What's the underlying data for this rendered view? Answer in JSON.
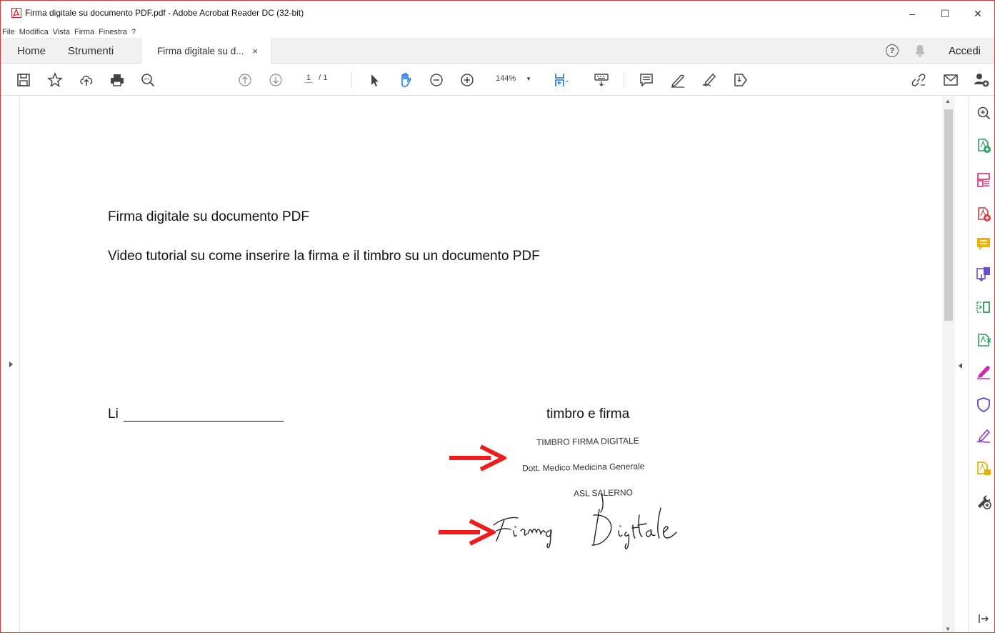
{
  "window": {
    "title": "Firma digitale su documento PDF.pdf - Adobe Acrobat Reader DC (32-bit)",
    "minimize": "–",
    "maximize": "☐",
    "close": "✕"
  },
  "menu": [
    "File",
    "Modifica",
    "Vista",
    "Firma",
    "Finestra",
    "?"
  ],
  "tabs": {
    "home": "Home",
    "tools": "Strumenti",
    "document": "Firma digitale su d...",
    "document_close": "×"
  },
  "header_right": {
    "help": "?",
    "signin": "Accedi"
  },
  "toolbar": {
    "page_current": "1",
    "page_total": "/ 1",
    "zoom": "144%",
    "zoom_arrow": "▼"
  },
  "document": {
    "heading": "Firma digitale su documento PDF",
    "subtitle": "Video tutorial su come inserire la firma e il timbro su un documento PDF",
    "place_label": "Li",
    "stamp_label": "timbro e firma",
    "stamp_lines": [
      "TIMBRO FIRMA DIGITALE",
      "Dott. Medico Medicina Generale",
      "ASL SALERNO"
    ],
    "signature": "Firma Digitale"
  },
  "colors": {
    "arrow": "#ee1c1c",
    "accent_blue": "#1473e6",
    "window_border": "#d23b3b"
  },
  "icons": {
    "toolbar_left": [
      "save-icon",
      "bookmark-star-icon",
      "upload-cloud-icon",
      "print-icon",
      "search-zoom-icon"
    ],
    "toolbar_nav": [
      "page-up-icon",
      "page-down-icon"
    ],
    "toolbar_tools": [
      "select-arrow-icon",
      "hand-tool-icon",
      "zoom-out-icon",
      "zoom-in-icon",
      "fit-page-icon",
      "keyboard-icon",
      "comment-icon",
      "highlight-pen-icon",
      "sign-icon",
      "stamp-icon"
    ],
    "toolbar_right": [
      "share-link-icon",
      "email-icon",
      "add-user-icon"
    ],
    "right_sidebar": [
      "zoom-search-icon",
      "create-pdf-icon",
      "organize-pages-icon",
      "export-pdf-icon",
      "comment-tool-icon",
      "combine-files-icon",
      "compress-icon",
      "scan-icon",
      "fill-sign-icon",
      "protect-icon",
      "signature-tool-icon",
      "send-for-review-icon",
      "more-tools-icon",
      "collapse-panel-icon"
    ]
  }
}
